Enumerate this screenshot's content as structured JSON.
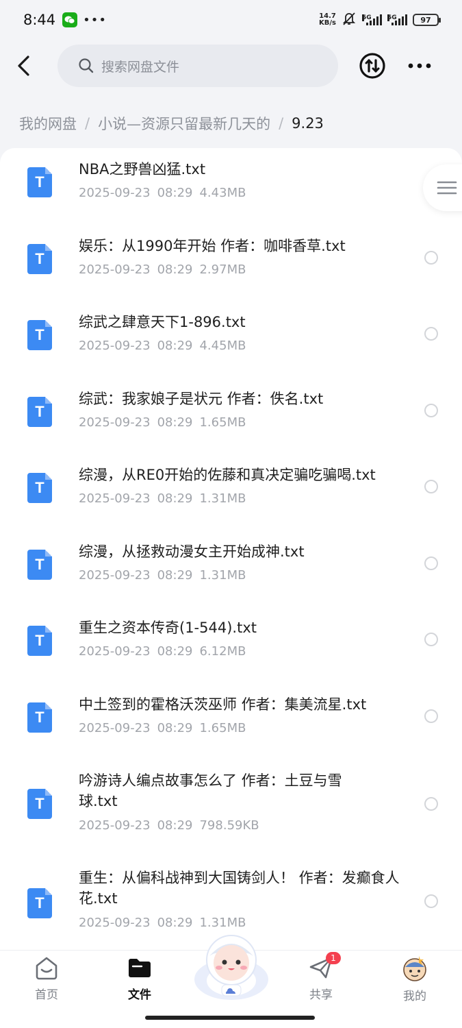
{
  "status_bar": {
    "time": "8:44",
    "dots": "•••",
    "net_speed_value": "14.7",
    "net_speed_unit": "KB/s",
    "sig1_label": "5G",
    "sig2_label": "5G",
    "battery": "97"
  },
  "header": {
    "search_placeholder": "搜索网盘文件"
  },
  "breadcrumb": {
    "items": [
      "我的网盘",
      "小说—资源只留最新几天的",
      "9.23"
    ],
    "separator": "/"
  },
  "files": [
    {
      "name": "NBA之野兽凶猛.txt",
      "date": "2025-09-23",
      "time": "08:29",
      "size": "4.43MB",
      "icon": "T"
    },
    {
      "name": "娱乐：从1990年开始 作者：咖啡香草.txt",
      "date": "2025-09-23",
      "time": "08:29",
      "size": "2.97MB",
      "icon": "T"
    },
    {
      "name": "综武之肆意天下1-896.txt",
      "date": "2025-09-23",
      "time": "08:29",
      "size": "4.45MB",
      "icon": "T"
    },
    {
      "name": "综武：我家娘子是状元 作者：佚名.txt",
      "date": "2025-09-23",
      "time": "08:29",
      "size": "1.65MB",
      "icon": "T"
    },
    {
      "name": "综漫，从RE0开始的佐藤和真决定骗吃骗喝.txt",
      "date": "2025-09-23",
      "time": "08:29",
      "size": "1.31MB",
      "icon": "T"
    },
    {
      "name": "综漫，从拯救动漫女主开始成神.txt",
      "date": "2025-09-23",
      "time": "08:29",
      "size": "1.31MB",
      "icon": "T"
    },
    {
      "name": "重生之资本传奇(1-544).txt",
      "date": "2025-09-23",
      "time": "08:29",
      "size": "6.12MB",
      "icon": "T"
    },
    {
      "name": "中土签到的霍格沃茨巫师 作者：集美流星.txt",
      "date": "2025-09-23",
      "time": "08:29",
      "size": "1.65MB",
      "icon": "T"
    },
    {
      "name": "吟游诗人编点故事怎么了 作者：土豆与雪球.txt",
      "date": "2025-09-23",
      "time": "08:29",
      "size": "798.59KB",
      "icon": "T"
    },
    {
      "name": "重生：从偏科战神到大国铸剑人！ 作者：发癫食人花.txt",
      "date": "2025-09-23",
      "time": "08:29",
      "size": "1.31MB",
      "icon": "T"
    }
  ],
  "bottom_nav": {
    "home": "首页",
    "files": "文件",
    "share": "共享",
    "share_badge": "1",
    "mine": "我的"
  },
  "colors": {
    "accent": "#3c8af3",
    "badge": "#f4404f",
    "page_bg": "#f3f4f7"
  }
}
